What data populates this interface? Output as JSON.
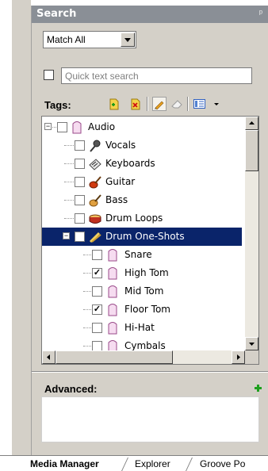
{
  "panel": {
    "title": "Search"
  },
  "match_select": {
    "value": "Match All"
  },
  "quick_search": {
    "placeholder": "Quick text search",
    "checked": false
  },
  "tags": {
    "label": "Tags:"
  },
  "tree": {
    "root": {
      "label": "Audio",
      "expanded": true
    },
    "items": [
      {
        "label": "Vocals",
        "icon": "microphone-icon",
        "checked": false
      },
      {
        "label": "Keyboards",
        "icon": "keyboard-icon",
        "checked": false
      },
      {
        "label": "Guitar",
        "icon": "guitar-icon",
        "checked": false
      },
      {
        "label": "Bass",
        "icon": "bass-icon",
        "checked": false
      },
      {
        "label": "Drum Loops",
        "icon": "drum-icon",
        "checked": false
      },
      {
        "label": "Drum One-Shots",
        "icon": "drumsticks-icon",
        "checked": false,
        "selected": true,
        "expanded": true
      },
      {
        "label": "Snare",
        "icon": "tag-icon",
        "checked": false
      },
      {
        "label": "High Tom",
        "icon": "tag-icon",
        "checked": true
      },
      {
        "label": "Mid Tom",
        "icon": "tag-icon",
        "checked": false
      },
      {
        "label": "Floor Tom",
        "icon": "tag-icon",
        "checked": true
      },
      {
        "label": "Hi-Hat",
        "icon": "tag-icon",
        "checked": false
      },
      {
        "label": "Cymbals",
        "icon": "tag-icon",
        "checked": false
      }
    ]
  },
  "advanced": {
    "label": "Advanced:"
  },
  "tabs": [
    {
      "label": "Media Manager",
      "active": true
    },
    {
      "label": "Explorer",
      "active": false
    },
    {
      "label": "Groove Po",
      "active": false
    }
  ],
  "colors": {
    "selection": "#0a246a",
    "titlebar": "#8a8f96",
    "panel": "#d4d0c8"
  }
}
